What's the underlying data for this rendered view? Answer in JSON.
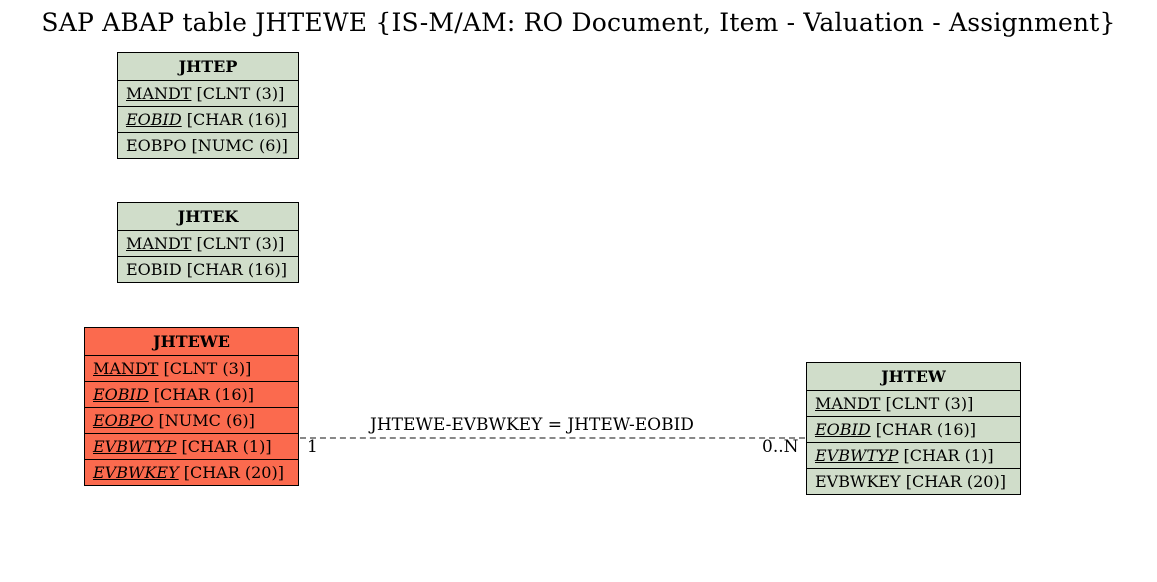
{
  "title": "SAP ABAP table JHTEWE {IS-M/AM: RO Document, Item - Valuation - Assignment}",
  "entities": {
    "jhtep": {
      "name": "JHTEP",
      "fields": [
        {
          "name": "MANDT",
          "type": "[CLNT (3)]",
          "u": true,
          "i": false
        },
        {
          "name": "EOBID",
          "type": "[CHAR (16)]",
          "u": true,
          "i": true
        },
        {
          "name": "EOBPO",
          "type": "[NUMC (6)]",
          "u": false,
          "i": false
        }
      ]
    },
    "jhtek": {
      "name": "JHTEK",
      "fields": [
        {
          "name": "MANDT",
          "type": "[CLNT (3)]",
          "u": true,
          "i": false
        },
        {
          "name": "EOBID",
          "type": "[CHAR (16)]",
          "u": false,
          "i": false
        }
      ]
    },
    "jhtewe": {
      "name": "JHTEWE",
      "fields": [
        {
          "name": "MANDT",
          "type": "[CLNT (3)]",
          "u": true,
          "i": false
        },
        {
          "name": "EOBID",
          "type": "[CHAR (16)]",
          "u": true,
          "i": true
        },
        {
          "name": "EOBPO",
          "type": "[NUMC (6)]",
          "u": true,
          "i": true
        },
        {
          "name": "EVBWTYP",
          "type": "[CHAR (1)]",
          "u": true,
          "i": true
        },
        {
          "name": "EVBWKEY",
          "type": "[CHAR (20)]",
          "u": true,
          "i": true
        }
      ]
    },
    "jhtew": {
      "name": "JHTEW",
      "fields": [
        {
          "name": "MANDT",
          "type": "[CLNT (3)]",
          "u": true,
          "i": false
        },
        {
          "name": "EOBID",
          "type": "[CHAR (16)]",
          "u": true,
          "i": true
        },
        {
          "name": "EVBWTYP",
          "type": "[CHAR (1)]",
          "u": true,
          "i": true
        },
        {
          "name": "EVBWKEY",
          "type": "[CHAR (20)]",
          "u": false,
          "i": false
        }
      ]
    }
  },
  "relationship": {
    "label": "JHTEWE-EVBWKEY = JHTEW-EOBID",
    "left_card": "1",
    "right_card": "0..N"
  }
}
